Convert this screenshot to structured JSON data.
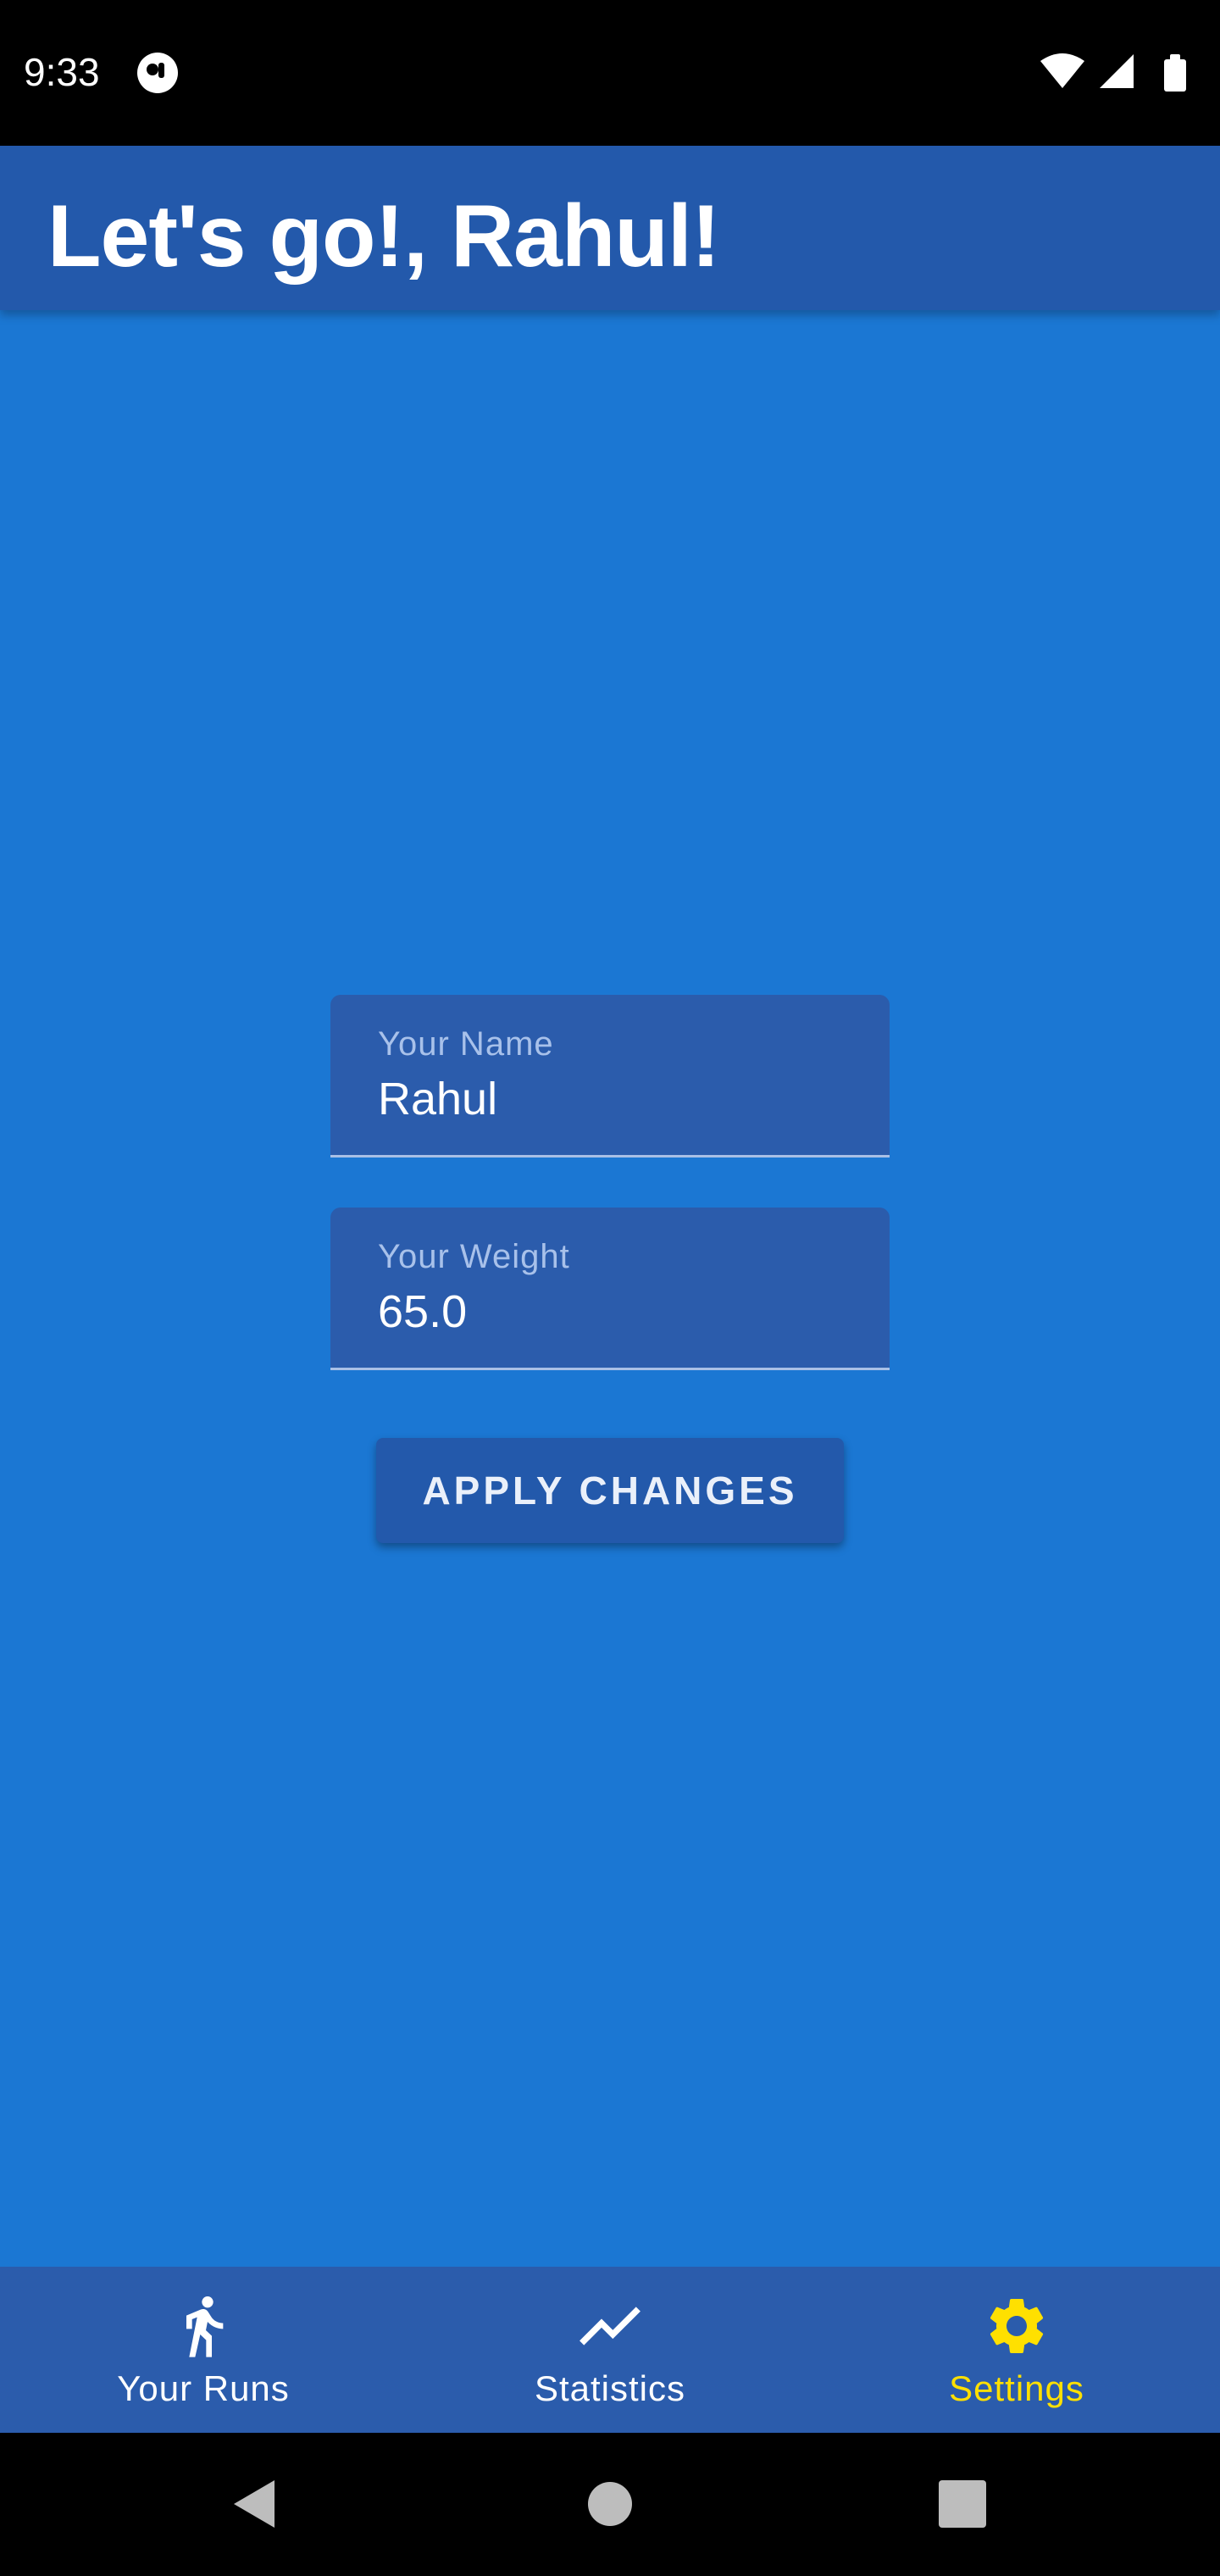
{
  "status_bar": {
    "time": "9:33",
    "app_icon": "running-app-icon",
    "icons": [
      "wifi-icon",
      "signal-icon",
      "battery-icon"
    ]
  },
  "app_bar": {
    "title": "Let's go!, Rahul!"
  },
  "form": {
    "name_field": {
      "label": "Your Name",
      "value": "Rahul"
    },
    "weight_field": {
      "label": "Your Weight",
      "value": "65.0"
    },
    "apply_button_label": "APPLY CHANGES"
  },
  "bottom_nav": {
    "items": [
      {
        "label": "Your Runs",
        "icon": "run-icon",
        "selected": false
      },
      {
        "label": "Statistics",
        "icon": "trending-up-icon",
        "selected": false
      },
      {
        "label": "Settings",
        "icon": "gear-icon",
        "selected": true
      }
    ]
  },
  "system_nav": {
    "buttons": [
      "back-icon",
      "home-icon",
      "recents-icon"
    ]
  },
  "colors": {
    "background": "#1b77d3",
    "app_bar": "#2359ab",
    "field_background": "#2b5cac",
    "selected_accent": "#ffe000"
  }
}
